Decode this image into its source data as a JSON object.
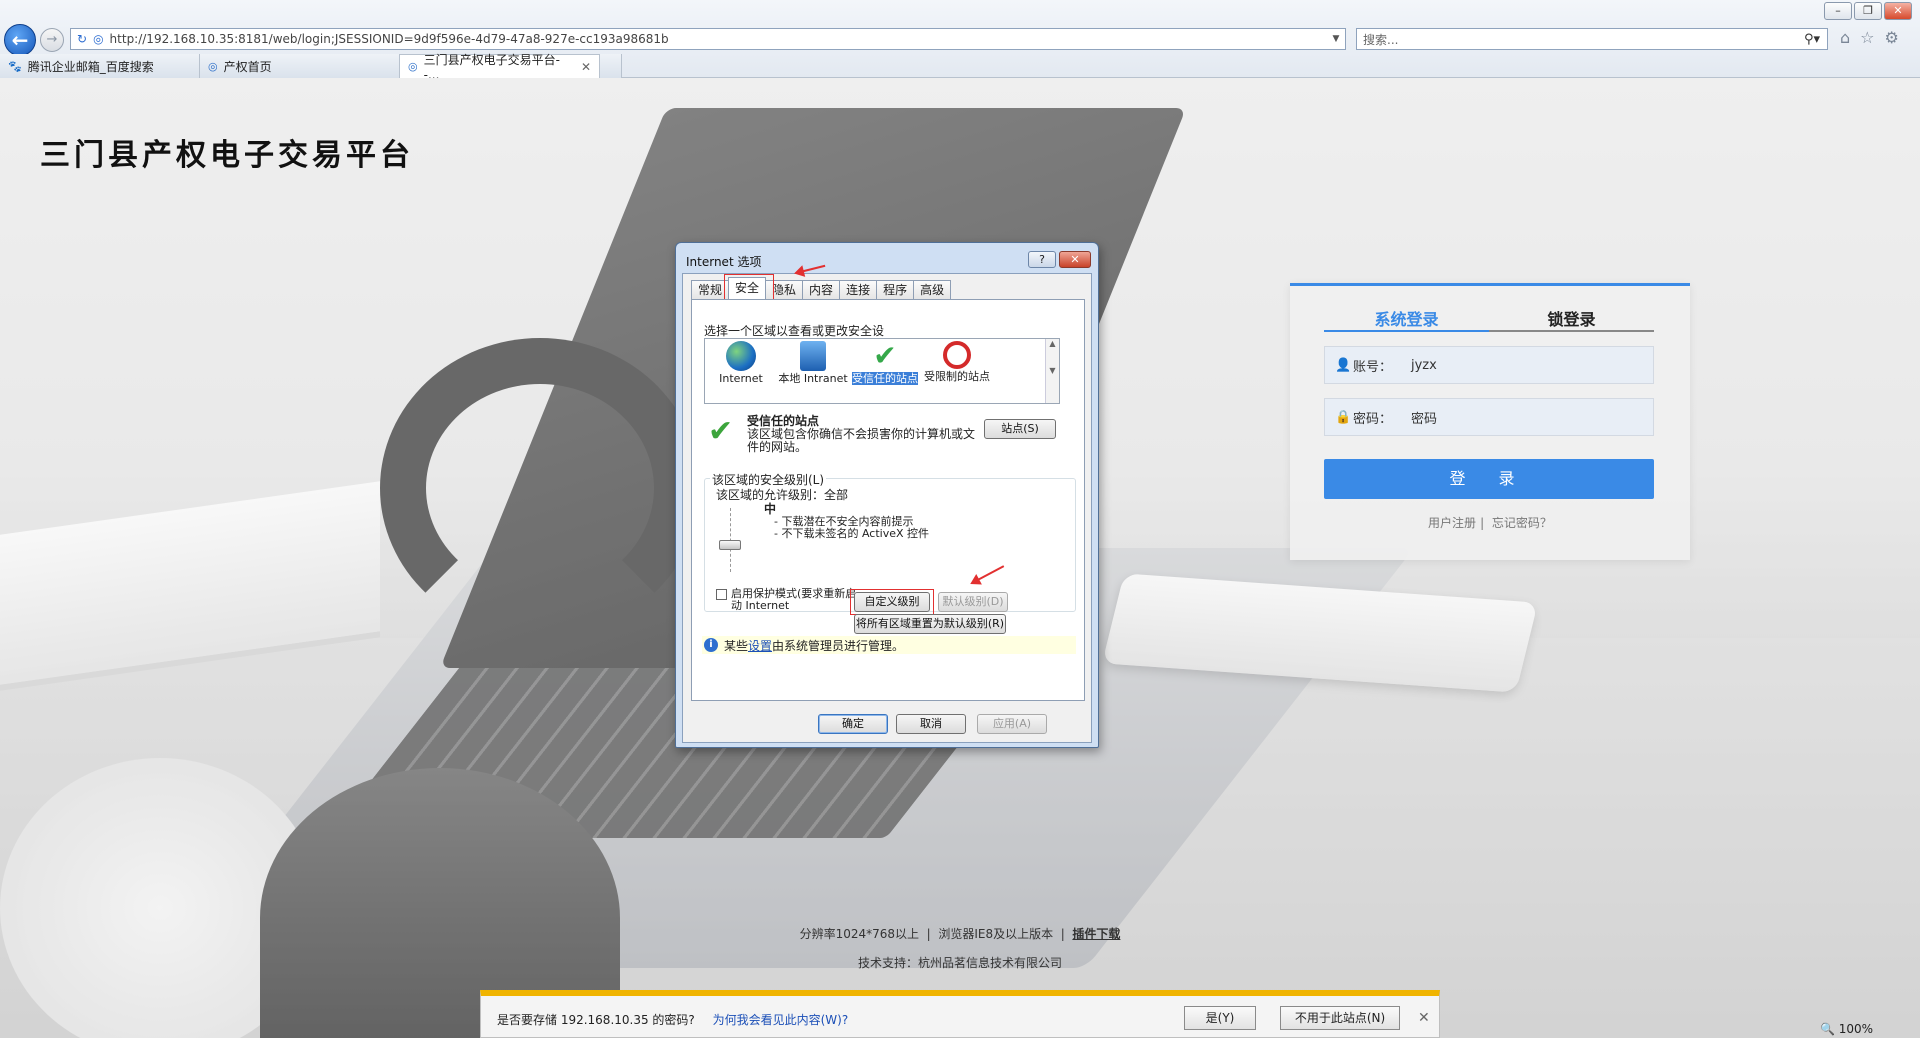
{
  "browser": {
    "address": "http://192.168.10.35:8181/web/login;JSESSIONID=9d9f596e-4d79-47a8-927e-cc193a98681b",
    "search_placeholder": "搜索...",
    "tabs": [
      {
        "label": "腾讯企业邮箱_百度搜索",
        "icon": "baidu-paw-icon"
      },
      {
        "label": "产权首页",
        "icon": "ie-page-icon"
      },
      {
        "label": "三门县产权电子交易平台--...",
        "icon": "ie-page-icon"
      }
    ],
    "zoom": "100%"
  },
  "site": {
    "title": "三门县产权电子交易平台",
    "login": {
      "tab_system": "系统登录",
      "tab_lock": "锁登录",
      "account_label": "账号：",
      "account_value": "jyzx",
      "password_label": "密码：",
      "password_value": "密码",
      "submit": "登 录",
      "register": "用户注册",
      "forgot": "忘记密码？"
    },
    "footer": {
      "resolution": "分辨率1024*768以上",
      "browser": "浏览器IE8及以上版本",
      "plugin": "插件下载",
      "support": "技术支持：杭州品茗信息技术有限公司"
    }
  },
  "dialog": {
    "title": "Internet 选项",
    "help": "?",
    "tabs": [
      "常规",
      "安全",
      "隐私",
      "内容",
      "连接",
      "程序",
      "高级"
    ],
    "zone_header": "选择一个区域以查看或更改安全设",
    "zones": [
      {
        "label": "Internet",
        "icon": "globe-icon"
      },
      {
        "label": "本地 Intranet",
        "icon": "intranet-icon"
      },
      {
        "label": "受信任的站点",
        "icon": "trusted-check-icon"
      },
      {
        "label": "受限制的站点",
        "icon": "restricted-icon"
      }
    ],
    "zone_title": "受信任的站点",
    "zone_desc": "该区域包含你确信不会损害你的计算机或文件的网站。",
    "sites_button": "站点(S)",
    "level_group": "该区域的安全级别(L)",
    "allowed_levels": "该区域的允许级别：全部",
    "level_name": "中",
    "level_desc": "- 下载潜在不安全内容前提示\n- 不下载未签名的 ActiveX 控件",
    "protected_mode": "启用保护模式(要求重新启动 Internet",
    "custom_button": "自定义级别(C)...",
    "default_button": "默认级别(D)",
    "reset_all_button": "将所有区域重置为默认级别(R)",
    "info_prefix": "某些",
    "info_link": "设置",
    "info_suffix": "由系统管理员进行管理。",
    "ok": "确定",
    "cancel": "取消",
    "apply": "应用(A)"
  },
  "notification": {
    "text": "是否要存储 192.168.10.35 的密码?",
    "why_link": "为何我会看见此内容(W)?",
    "yes": "是(Y)",
    "never": "不用于此站点(N)"
  },
  "colors": {
    "accent": "#3a8ae6",
    "annotation_red": "#e23030",
    "notif_bar": "#f0b400"
  }
}
